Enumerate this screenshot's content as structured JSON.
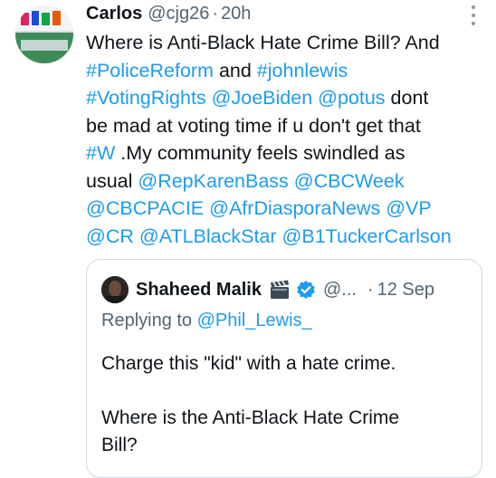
{
  "tweet": {
    "author_name": "Carlos",
    "author_handle": "@cjg26",
    "separator": "·",
    "time": "20h",
    "lines": [
      [
        {
          "t": "Where is Anti-Black Hate Crime Bill? And",
          "link": false
        }
      ],
      [
        {
          "t": "#PoliceReform",
          "link": true
        },
        {
          "t": " and ",
          "link": false
        },
        {
          "t": "#johnlewis",
          "link": true
        }
      ],
      [
        {
          "t": "#VotingRights",
          "link": true
        },
        {
          "t": " ",
          "link": false
        },
        {
          "t": "@JoeBiden",
          "link": true
        },
        {
          "t": " ",
          "link": false
        },
        {
          "t": "@potus",
          "link": true
        },
        {
          "t": " dont",
          "link": false
        }
      ],
      [
        {
          "t": "be mad at voting time if u don't get that",
          "link": false
        }
      ],
      [
        {
          "t": "#W",
          "link": true
        },
        {
          "t": " .My community feels swindled as",
          "link": false
        }
      ],
      [
        {
          "t": "usual ",
          "link": false
        },
        {
          "t": "@RepKarenBass",
          "link": true
        },
        {
          "t": " ",
          "link": false
        },
        {
          "t": "@CBCWeek",
          "link": true
        }
      ],
      [
        {
          "t": "@CBCPACIE",
          "link": true
        },
        {
          "t": " ",
          "link": false
        },
        {
          "t": "@AfrDiasporaNews",
          "link": true
        },
        {
          "t": " ",
          "link": false
        },
        {
          "t": "@VP",
          "link": true
        }
      ],
      [
        {
          "t": "@CR",
          "link": true
        },
        {
          "t": " ",
          "link": false
        },
        {
          "t": "@ATLBlackStar",
          "link": true
        },
        {
          "t": " ",
          "link": false
        },
        {
          "t": "@B1TuckerCarlson",
          "link": true
        }
      ]
    ]
  },
  "quoted_tweet": {
    "author_name": "Shaheed Malik",
    "author_handle": "@...",
    "separator": "·",
    "date": "12 Sep",
    "replying_prefix": "Replying to ",
    "replying_handle": "@Phil_Lewis_",
    "paragraphs": [
      [
        "Charge this \"kid\" with a  hate crime."
      ],
      [
        "Where is the Anti-Black Hate Crime",
        "Bill?"
      ]
    ]
  },
  "icons": {
    "avatar": "profile-avatar",
    "more": "more-options-icon",
    "clapper": "clapperboard-icon",
    "verified": "verified-badge-icon"
  },
  "colors": {
    "link": "#1d9bf0",
    "secondary_text": "#536471",
    "primary_text": "#0f1419",
    "verified": "#1d9bf0",
    "border": "#cfd9de"
  }
}
